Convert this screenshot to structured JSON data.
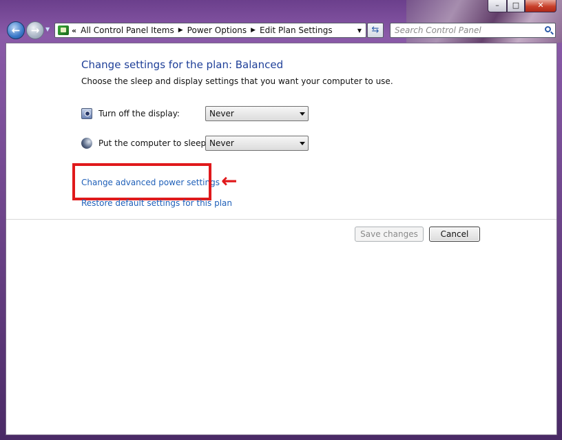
{
  "titlebar": {
    "minimize_icon": "minimize-icon",
    "maximize_icon": "maximize-icon",
    "close_icon": "close-icon"
  },
  "nav": {
    "back_icon": "back-arrow-icon",
    "forward_icon": "forward-arrow-icon",
    "breadcrumb_lead": "«",
    "breadcrumb": [
      "All Control Panel Items",
      "Power Options",
      "Edit Plan Settings"
    ],
    "search_placeholder": "Search Control Panel",
    "refresh_icon": "refresh-icon",
    "search_icon": "search-icon"
  },
  "main": {
    "heading": "Change settings for the plan: Balanced",
    "subtext": "Choose the sleep and display settings that you want your computer to use.",
    "rows": [
      {
        "label": "Turn off the display:",
        "value": "Never",
        "icon": "display-timer-icon"
      },
      {
        "label": "Put the computer to sleep:",
        "value": "Never",
        "icon": "sleep-moon-icon"
      }
    ],
    "link_advanced": "Change advanced power settings",
    "link_restore": "Restore default settings for this plan",
    "annotation_arrow": "🡐",
    "annotation_color": "#e0191b"
  },
  "buttons": {
    "save": "Save changes",
    "cancel": "Cancel"
  }
}
